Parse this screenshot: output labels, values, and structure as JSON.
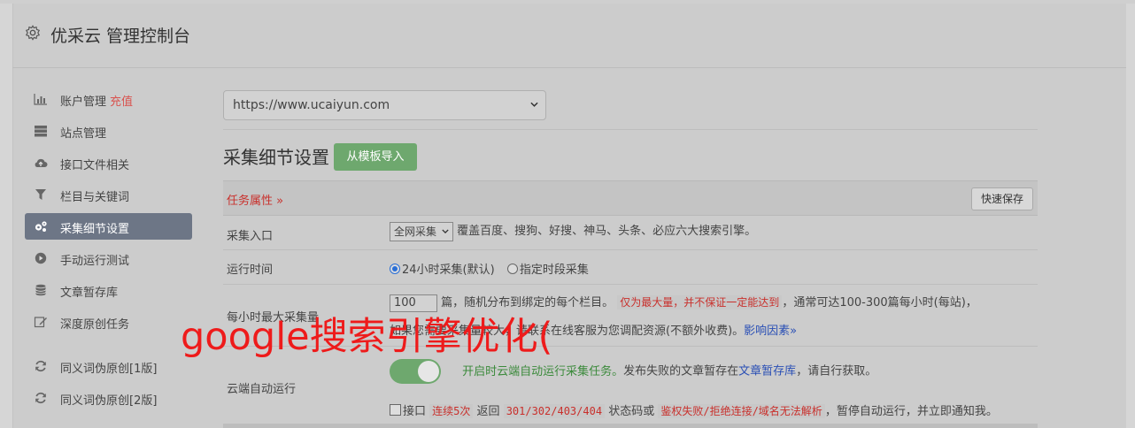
{
  "header": {
    "title": "优采云 管理控制台",
    "icon": "gear-icon"
  },
  "sidebar": {
    "items": [
      {
        "label": "账户管理",
        "extra": "充值",
        "icon": "bar-chart-icon"
      },
      {
        "label": "站点管理",
        "icon": "server-icon"
      },
      {
        "label": "接口文件相关",
        "icon": "cloud-upload-icon"
      },
      {
        "label": "栏目与关键词",
        "icon": "filter-icon"
      },
      {
        "label": "采集细节设置",
        "icon": "cogs-icon",
        "active": true
      },
      {
        "label": "手动运行测试",
        "icon": "play-circle-icon"
      },
      {
        "label": "文章暂存库",
        "icon": "database-icon"
      },
      {
        "label": "深度原创任务",
        "icon": "edit-icon"
      },
      {
        "label": "同义词伪原创[1版]",
        "icon": "refresh-icon"
      },
      {
        "label": "同义词伪原创[2版]",
        "icon": "refresh-icon"
      }
    ]
  },
  "main": {
    "site_select": {
      "value": "https://www.ucaiyun.com"
    },
    "section_title": "采集细节设置",
    "import_button": "从模板导入",
    "task_header": {
      "label": "任务属性 »",
      "quick_save": "快速保存"
    },
    "rows": {
      "entry": {
        "label": "采集入口",
        "select_value": "全网采集",
        "desc": "覆盖百度、搜狗、好搜、神马、头条、必应六大搜索引擎。"
      },
      "runtime": {
        "label": "运行时间",
        "option1": "24小时采集(默认)",
        "option2": "指定时段采集"
      },
      "max_per_hour": {
        "label": "每小时最大采集量",
        "input_value": "100",
        "text1": "篇，随机分布到绑定的每个栏目。",
        "warn": "仅为最大量，并不保证一定能达到",
        "text2": "，通常可达100-300篇每小时(每站)，",
        "line2_a": "如果您需要采集量较大，请联系在线客服为您调配资源(不额外收费)。",
        "line2_link": "影响因素»"
      },
      "cloud_run": {
        "label": "云端自动运行",
        "enabled": true,
        "desc_green": "开启时云端自动运行采集任务。",
        "desc_a": "发布失败的文章暂存在",
        "desc_link": "文章暂存库",
        "desc_b": "，请自行获取。",
        "check_label": "接口",
        "code1": "连续5次",
        "text_return": "返回",
        "code2": "301/302/403/404",
        "text_status": "状态码或",
        "code3": "鉴权失败/拒绝连接/域名无法解析",
        "text_end": "，暂停自动运行，并立即通知我。"
      }
    }
  },
  "overlay": {
    "text": "google搜索引擎优化("
  },
  "colors": {
    "accent_red": "#c9302c",
    "success_green": "#6ea86e",
    "link_blue": "#2a4fb5",
    "active_nav": "#6d7686"
  }
}
